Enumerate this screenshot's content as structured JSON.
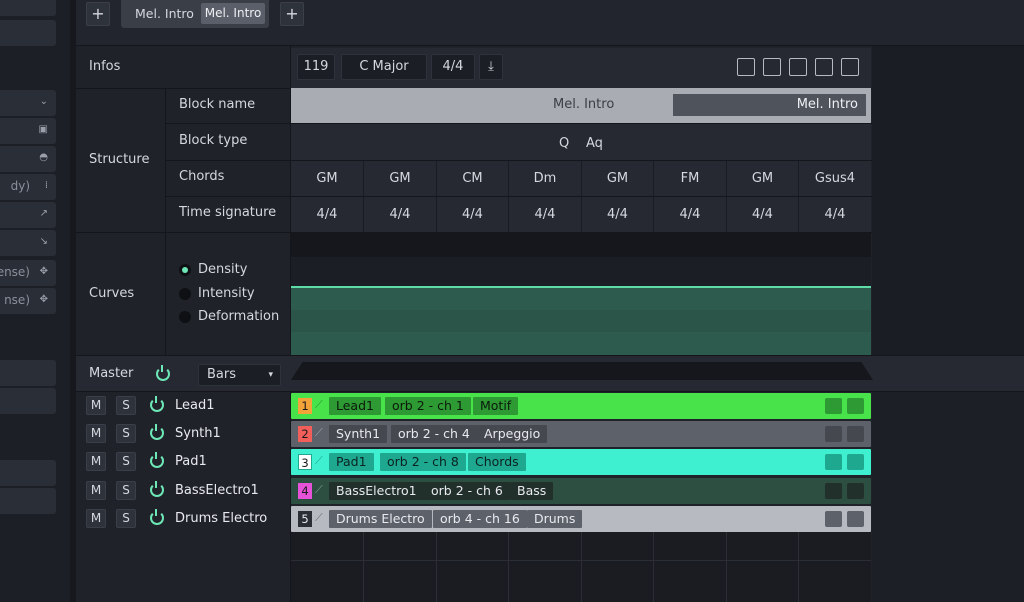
{
  "sidebar": {
    "items": [
      {
        "text": "",
        "icon": "⌄"
      },
      {
        "text": "",
        "icon": "▣"
      },
      {
        "text": "",
        "icon": "◓"
      },
      {
        "text": "dy)",
        "icon": "⁞"
      },
      {
        "text": "",
        "icon": "↗"
      },
      {
        "text": "",
        "icon": "↘"
      },
      {
        "text": "ense)",
        "icon": "✥"
      },
      {
        "text": "nse)",
        "icon": "✥"
      }
    ]
  },
  "topbar": {
    "add_left": "+",
    "add_right": "+",
    "block_tab": "Mel. Intro",
    "block_tab_active": "Mel. Intro"
  },
  "infos": {
    "label": "Infos",
    "tempo": "119",
    "key": "C Major",
    "time_sig": "4/4",
    "download_icon": "⤓"
  },
  "structure": {
    "label": "Structure",
    "block_name_label": "Block name",
    "block_name_placeholder": "Mel. Intro",
    "block_name_value": "Mel. Intro",
    "block_type_label": "Block type",
    "block_type_q": "Q",
    "block_type_aq": "Aq",
    "chords_label": "Chords",
    "chords": [
      "GM",
      "GM",
      "CM",
      "Dm",
      "GM",
      "FM",
      "GM",
      "Gsus4"
    ],
    "time_sig_label": "Time signature",
    "time_sigs": [
      "4/4",
      "4/4",
      "4/4",
      "4/4",
      "4/4",
      "4/4",
      "4/4",
      "4/4"
    ]
  },
  "curves": {
    "label": "Curves",
    "options": [
      "Density",
      "Intensity",
      "Deformation"
    ],
    "selected": "Density"
  },
  "master": {
    "label": "Master",
    "select_value": "Bars"
  },
  "tracks": [
    {
      "m": "M",
      "s": "S",
      "name": "Lead1",
      "num": "1",
      "chip1": "Lead1",
      "chip2": "orb 2 - ch 1",
      "chip3": "Motif",
      "lane_color": "#48e24b",
      "chip_color": "#2d9a33",
      "num_bg": "#f3a338",
      "text_color": "#0b1a0b"
    },
    {
      "m": "M",
      "s": "S",
      "name": "Synth1",
      "num": "2",
      "chip1": "Synth1",
      "chip2": "orb 2 - ch 4",
      "chip3": "Arpeggio",
      "lane_color": "#5d616a",
      "chip_color": "#45484f",
      "num_bg": "#f25e59",
      "text_color": "#e8eaee"
    },
    {
      "m": "M",
      "s": "S",
      "name": "Pad1",
      "num": "3",
      "chip1": "Pad1",
      "chip2": "orb 2 - ch 8",
      "chip3": "Chords",
      "lane_color": "#3ef0d0",
      "chip_color": "#1fa890",
      "num_bg": "#ffffff",
      "text_color": "#0b2220"
    },
    {
      "m": "M",
      "s": "S",
      "name": "BassElectro1",
      "num": "4",
      "chip1": "BassElectro1",
      "chip2": "orb 2 - ch 6",
      "chip3": "Bass",
      "lane_color": "#2c4f42",
      "chip_color": "#22302c",
      "num_bg": "#e653d9",
      "text_color": "#e8eaee"
    },
    {
      "m": "M",
      "s": "S",
      "name": "Drums Electro",
      "num": "5",
      "chip1": "Drums Electro",
      "chip2": "orb 4 - ch 16",
      "chip3": "Drums",
      "lane_color": "#b7bac0",
      "chip_color": "#5d616a",
      "num_bg": "#2b2e35",
      "text_color": "#e8eaee"
    }
  ]
}
